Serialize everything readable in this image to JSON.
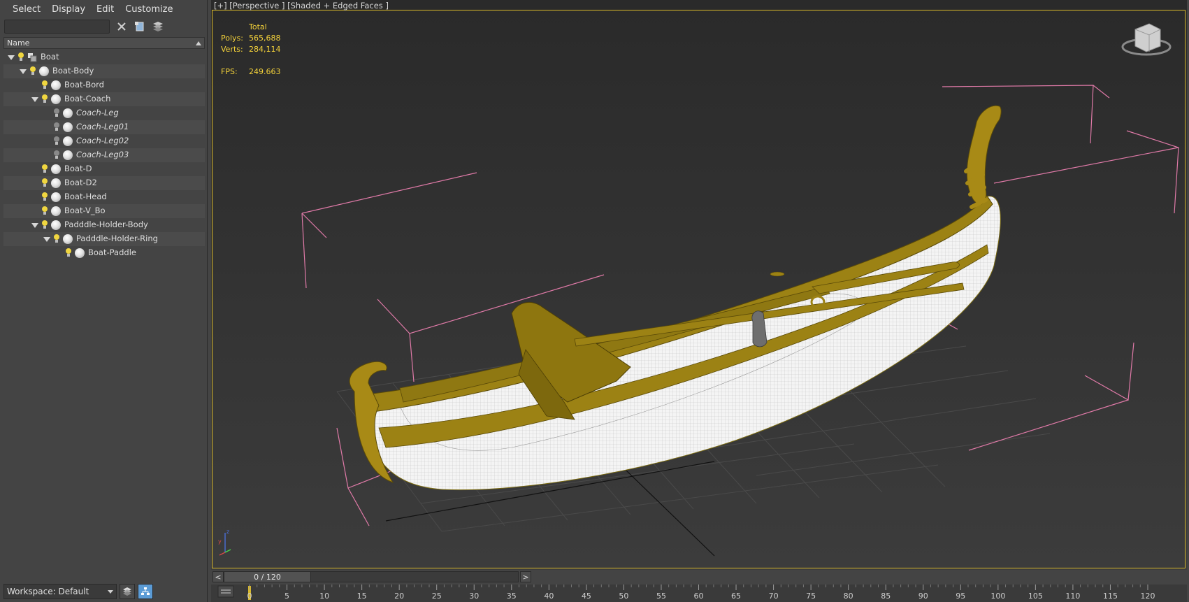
{
  "menu": {
    "items": [
      "Select",
      "Display",
      "Edit",
      "Customize"
    ]
  },
  "explorer": {
    "search": {
      "value": "",
      "placeholder": ""
    },
    "toolbar": {
      "clear_icon": "close-icon",
      "display_icon": "filter-display-icon",
      "settings_icon": "layer-settings-icon"
    },
    "column_header": "Name",
    "tree": [
      {
        "label": "Boat",
        "depth": 0,
        "expanded": true,
        "icon": "group",
        "light": "on",
        "italic": false
      },
      {
        "label": "Boat-Body",
        "depth": 1,
        "expanded": true,
        "icon": "sphere",
        "light": "on",
        "italic": false
      },
      {
        "label": "Boat-Bord",
        "depth": 2,
        "expanded": false,
        "icon": "sphere",
        "light": "on",
        "italic": false
      },
      {
        "label": "Boat-Coach",
        "depth": 2,
        "expanded": true,
        "icon": "sphere",
        "light": "on",
        "italic": false
      },
      {
        "label": "Coach-Leg",
        "depth": 3,
        "expanded": false,
        "icon": "sphere",
        "light": "off",
        "italic": true
      },
      {
        "label": "Coach-Leg01",
        "depth": 3,
        "expanded": false,
        "icon": "sphere",
        "light": "off",
        "italic": true
      },
      {
        "label": "Coach-Leg02",
        "depth": 3,
        "expanded": false,
        "icon": "sphere",
        "light": "off",
        "italic": true
      },
      {
        "label": "Coach-Leg03",
        "depth": 3,
        "expanded": false,
        "icon": "sphere",
        "light": "off",
        "italic": true
      },
      {
        "label": "Boat-D",
        "depth": 2,
        "expanded": false,
        "icon": "sphere",
        "light": "on",
        "italic": false
      },
      {
        "label": "Boat-D2",
        "depth": 2,
        "expanded": false,
        "icon": "sphere",
        "light": "on",
        "italic": false
      },
      {
        "label": "Boat-Head",
        "depth": 2,
        "expanded": false,
        "icon": "sphere",
        "light": "on",
        "italic": false
      },
      {
        "label": "Boat-V_Bo",
        "depth": 2,
        "expanded": false,
        "icon": "sphere",
        "light": "on",
        "italic": false
      },
      {
        "label": "Padddle-Holder-Body",
        "depth": 2,
        "expanded": true,
        "icon": "sphere",
        "light": "on",
        "italic": false
      },
      {
        "label": "Padddle-Holder-Ring",
        "depth": 3,
        "expanded": true,
        "icon": "sphere",
        "light": "on",
        "italic": false
      },
      {
        "label": "Boat-Paddle",
        "depth": 4,
        "expanded": false,
        "icon": "sphere",
        "light": "on",
        "italic": false
      }
    ],
    "workspace": "Workspace: Default"
  },
  "viewport": {
    "label": "[+] [Perspective ] [Shaded + Edged Faces ]",
    "stats": {
      "total_label": "Total",
      "polys_label": "Polys:",
      "polys_value": "565,688",
      "verts_label": "Verts:",
      "verts_value": "284,114",
      "fps_label": "FPS:",
      "fps_value": "249.663"
    },
    "colors": {
      "border": "#d8b82a",
      "stats": "#f4d23a",
      "boat_gold": "#9c8214",
      "boat_white": "#f2f2f2",
      "bbox": "#e07aa8",
      "grid": "#474747"
    }
  },
  "timeline": {
    "counter": "0 / 120",
    "prev": "<",
    "next": ">",
    "ticks": [
      "0",
      "5",
      "10",
      "15",
      "20",
      "25",
      "30",
      "35",
      "40",
      "45",
      "50",
      "55",
      "60",
      "65",
      "70",
      "75",
      "80",
      "85",
      "90",
      "95",
      "100",
      "105",
      "110",
      "115",
      "120"
    ]
  }
}
